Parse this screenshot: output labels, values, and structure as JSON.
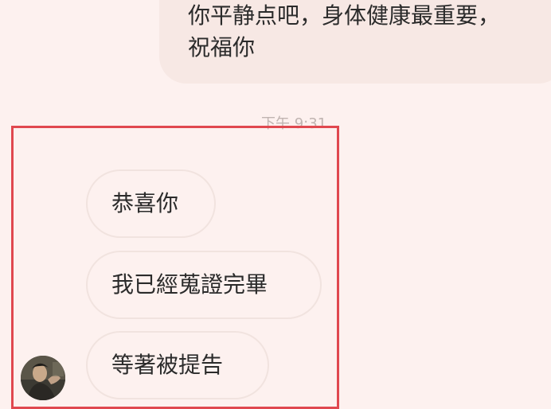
{
  "outgoing_message": {
    "lines": [
      "你平静点吧，身体健康最重要，",
      "祝福你"
    ]
  },
  "timestamp": "下午 9:31",
  "incoming_messages": [
    {
      "text": "恭喜你"
    },
    {
      "text": "我已經蒐證完畢"
    },
    {
      "text": "等著被提告"
    }
  ],
  "colors": {
    "background": "#fdf1ef",
    "outgoing_bubble": "#f7e8e4",
    "incoming_bubble_border": "#f1e3df",
    "highlight_border": "#e0484f",
    "timestamp": "#c0b4b1"
  }
}
